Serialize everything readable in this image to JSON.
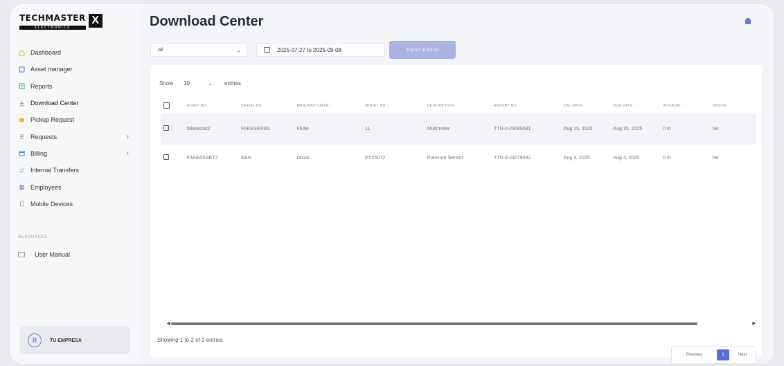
{
  "brand": {
    "name": "TECHMASTER",
    "sub": "ELECTRONICS",
    "mark": "X"
  },
  "sidebar": {
    "items": [
      {
        "label": "Dashboard",
        "icon": "home-icon"
      },
      {
        "label": "Asset manager",
        "icon": "box-icon"
      },
      {
        "label": "Reports",
        "icon": "report-icon"
      },
      {
        "label": "Download Center",
        "icon": "download-icon"
      },
      {
        "label": "Pickup Request",
        "icon": "truck-icon"
      },
      {
        "label": "Requests",
        "icon": "list-icon"
      },
      {
        "label": "Billing",
        "icon": "calendar-icon"
      },
      {
        "label": "Internal Transfers",
        "icon": "transfer-icon"
      },
      {
        "label": "Employees",
        "icon": "users-icon"
      },
      {
        "label": "Mobile Devices",
        "icon": "phone-icon"
      }
    ],
    "resources_title": "RESOURCES",
    "user_manual": "User Manual",
    "company": "TU EMPRESA"
  },
  "page": {
    "title": "Download Center"
  },
  "filters": {
    "type_selected": "All",
    "date_range": "2025-07-27 to 2025-09-08",
    "export_label": "Export to Excel"
  },
  "table": {
    "show_label": "Show",
    "page_size": "10",
    "entries_label": "entries",
    "columns": [
      "ASSET NO",
      "SERIAL NO",
      "MANUFACTURER",
      "MODEL NO",
      "DESCRIPTION",
      "REPORT NO",
      "CAL DATE",
      "DUE DATE",
      "INTERVAL",
      "ONSITE"
    ],
    "rows": [
      [
        "fakeasset2",
        "FAKESERIAL",
        "Fluke",
        "11",
        "Multimeter",
        "TTU-0-23089581",
        "Aug 15, 2025",
        "Aug 15, 2025",
        "0 m",
        "No"
      ],
      [
        "FAKEASSET2",
        "NSN",
        "Druck",
        "PTX5072",
        "Pressure Sensor",
        "TTU-0-23079482",
        "Aug 4, 2025",
        "Aug 4, 2025",
        "0 m",
        "No"
      ]
    ],
    "info": "Showing 1 to 2 of 2 entries"
  },
  "pagination": {
    "previous": "Previous",
    "current": "1",
    "next": "Next"
  },
  "colors": {
    "accent": "#5a6fd6",
    "export_button": "#aab4e3"
  }
}
